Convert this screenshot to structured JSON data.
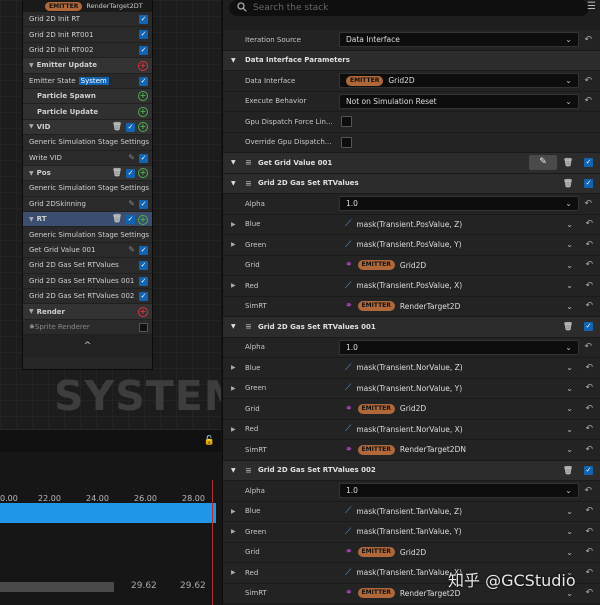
{
  "node": {
    "top_tag": "EMITTER",
    "top_title": "RenderTarget2DT",
    "rows": [
      {
        "label": "Grid 2D Init RT",
        "kind": "item",
        "state": "checked"
      },
      {
        "label": "Grid 2D Init RT001",
        "kind": "item",
        "state": "checked"
      },
      {
        "label": "Grid 2D Init RT002",
        "kind": "item",
        "state": "checked"
      },
      {
        "label": "Emitter Update",
        "kind": "header",
        "state": "red-plus"
      },
      {
        "label": "Emitter State",
        "kind": "item",
        "extra": "System",
        "state": "checked"
      },
      {
        "label": "Particle Spawn",
        "kind": "sub",
        "state": "plus"
      },
      {
        "label": "Particle Update",
        "kind": "sub",
        "state": "plus"
      },
      {
        "label": "VID",
        "kind": "header",
        "state": "stage"
      },
      {
        "label": "Generic Simulation Stage Settings",
        "kind": "item",
        "state": "none"
      },
      {
        "label": "Write VID",
        "kind": "item",
        "state": "edit"
      },
      {
        "label": "Pos",
        "kind": "header",
        "state": "stage"
      },
      {
        "label": "Generic Simulation Stage Settings",
        "kind": "item",
        "state": "none"
      },
      {
        "label": "Grid 2DSkinning",
        "kind": "item",
        "state": "edit"
      },
      {
        "label": "RT",
        "kind": "header-sel",
        "state": "stage"
      },
      {
        "label": "Generic Simulation Stage Settings",
        "kind": "item",
        "state": "none"
      },
      {
        "label": "Get Grid Value 001",
        "kind": "item",
        "state": "edit"
      },
      {
        "label": "Grid 2D Gas Set RTValues",
        "kind": "item",
        "state": "checked"
      },
      {
        "label": "Grid 2D Gas Set RTValues 001",
        "kind": "item",
        "state": "checked"
      },
      {
        "label": "Grid 2D Gas Set RTValues 002",
        "kind": "item",
        "state": "checked"
      },
      {
        "label": "Render",
        "kind": "header",
        "state": "red-plus"
      },
      {
        "label": "Sprite Renderer",
        "kind": "renderer",
        "state": "off"
      }
    ],
    "footer": "^"
  },
  "watermark_system": "SYSTEM",
  "timeline": {
    "ticks": [
      "0.00",
      "22.00",
      "24.00",
      "26.00",
      "28.00"
    ],
    "end_values": [
      "29.62",
      "29.62"
    ]
  },
  "search": {
    "placeholder": "Search the stack"
  },
  "panel": [
    {
      "type": "prop",
      "label": "Iteration Source",
      "value": "Data Interface",
      "style": "box",
      "dd": true,
      "reset": true
    },
    {
      "type": "section",
      "title": "Data Interface Parameters",
      "hamburger": false
    },
    {
      "type": "prop",
      "label": "Data Interface",
      "tag": "EMITTER",
      "value": "Grid2D",
      "style": "box",
      "dd": true,
      "reset": true
    },
    {
      "type": "prop",
      "label": "Execute Behavior",
      "value": "Not on Simulation Reset",
      "style": "box",
      "dd": true,
      "reset": true
    },
    {
      "type": "prop",
      "label": "Gpu Dispatch Force Lin...",
      "checkbox": true
    },
    {
      "type": "prop",
      "label": "Override Gpu Dispatch...",
      "checkbox": true
    },
    {
      "type": "section",
      "title": "Get Grid Value 001",
      "hamburger": true,
      "pen": true
    },
    {
      "type": "section",
      "title": "Grid 2D Gas Set RTValues",
      "hamburger": true
    },
    {
      "type": "prop",
      "label": "Alpha",
      "value": "1.0",
      "style": "box",
      "dd": true,
      "reset": true
    },
    {
      "type": "prop",
      "label": "Blue",
      "expand": true,
      "icon": "graph",
      "value": "mask(Transient.PosValue, Z)",
      "style": "plain",
      "dd": true,
      "reset": true
    },
    {
      "type": "prop",
      "label": "Green",
      "expand": true,
      "icon": "graph",
      "value": "mask(Transient.PosValue, Y)",
      "style": "plain",
      "dd": true,
      "reset": true
    },
    {
      "type": "prop",
      "label": "Grid",
      "icon": "link",
      "tag": "EMITTER",
      "value": "Grid2D",
      "style": "plain",
      "dd": true,
      "reset": true
    },
    {
      "type": "prop",
      "label": "Red",
      "expand": true,
      "icon": "graph",
      "value": "mask(Transient.PosValue, X)",
      "style": "plain",
      "dd": true,
      "reset": true
    },
    {
      "type": "prop",
      "label": "SimRT",
      "icon": "link",
      "tag": "EMITTER",
      "value": "RenderTarget2D",
      "style": "plain",
      "dd": true,
      "reset": true
    },
    {
      "type": "section",
      "title": "Grid 2D Gas Set RTValues 001",
      "hamburger": true
    },
    {
      "type": "prop",
      "label": "Alpha",
      "value": "1.0",
      "style": "box",
      "dd": true,
      "reset": true
    },
    {
      "type": "prop",
      "label": "Blue",
      "expand": true,
      "icon": "graph",
      "value": "mask(Transient.NorValue, Z)",
      "style": "plain",
      "dd": true,
      "reset": true
    },
    {
      "type": "prop",
      "label": "Green",
      "expand": true,
      "icon": "graph",
      "value": "mask(Transient.NorValue, Y)",
      "style": "plain",
      "dd": true,
      "reset": true
    },
    {
      "type": "prop",
      "label": "Grid",
      "icon": "link",
      "tag": "EMITTER",
      "value": "Grid2D",
      "style": "plain",
      "dd": true,
      "reset": true
    },
    {
      "type": "prop",
      "label": "Red",
      "expand": true,
      "icon": "graph",
      "value": "mask(Transient.NorValue, X)",
      "style": "plain",
      "dd": true,
      "reset": true
    },
    {
      "type": "prop",
      "label": "SimRT",
      "icon": "link",
      "tag": "EMITTER",
      "value": "RenderTarget2DN",
      "style": "plain",
      "dd": true,
      "reset": true
    },
    {
      "type": "section",
      "title": "Grid 2D Gas Set RTValues 002",
      "hamburger": true
    },
    {
      "type": "prop",
      "label": "Alpha",
      "value": "1.0",
      "style": "box",
      "dd": true,
      "reset": true
    },
    {
      "type": "prop",
      "label": "Blue",
      "expand": true,
      "icon": "graph",
      "value": "mask(Transient.TanValue, Z)",
      "style": "plain",
      "dd": true,
      "reset": true
    },
    {
      "type": "prop",
      "label": "Green",
      "expand": true,
      "icon": "graph",
      "value": "mask(Transient.TanValue, Y)",
      "style": "plain",
      "dd": true,
      "reset": true
    },
    {
      "type": "prop",
      "label": "Grid",
      "icon": "link",
      "tag": "EMITTER",
      "value": "Grid2D",
      "style": "plain",
      "dd": true,
      "reset": true
    },
    {
      "type": "prop",
      "label": "Red",
      "expand": true,
      "icon": "graph",
      "value": "mask(Transient.TanValue, X)",
      "style": "plain",
      "dd": true,
      "reset": true
    },
    {
      "type": "prop",
      "label": "SimRT",
      "icon": "link",
      "tag": "EMITTER",
      "value": "RenderTarget2D",
      "style": "plain",
      "dd": true,
      "reset": true
    }
  ],
  "watermark": "知乎 @GCStudio"
}
